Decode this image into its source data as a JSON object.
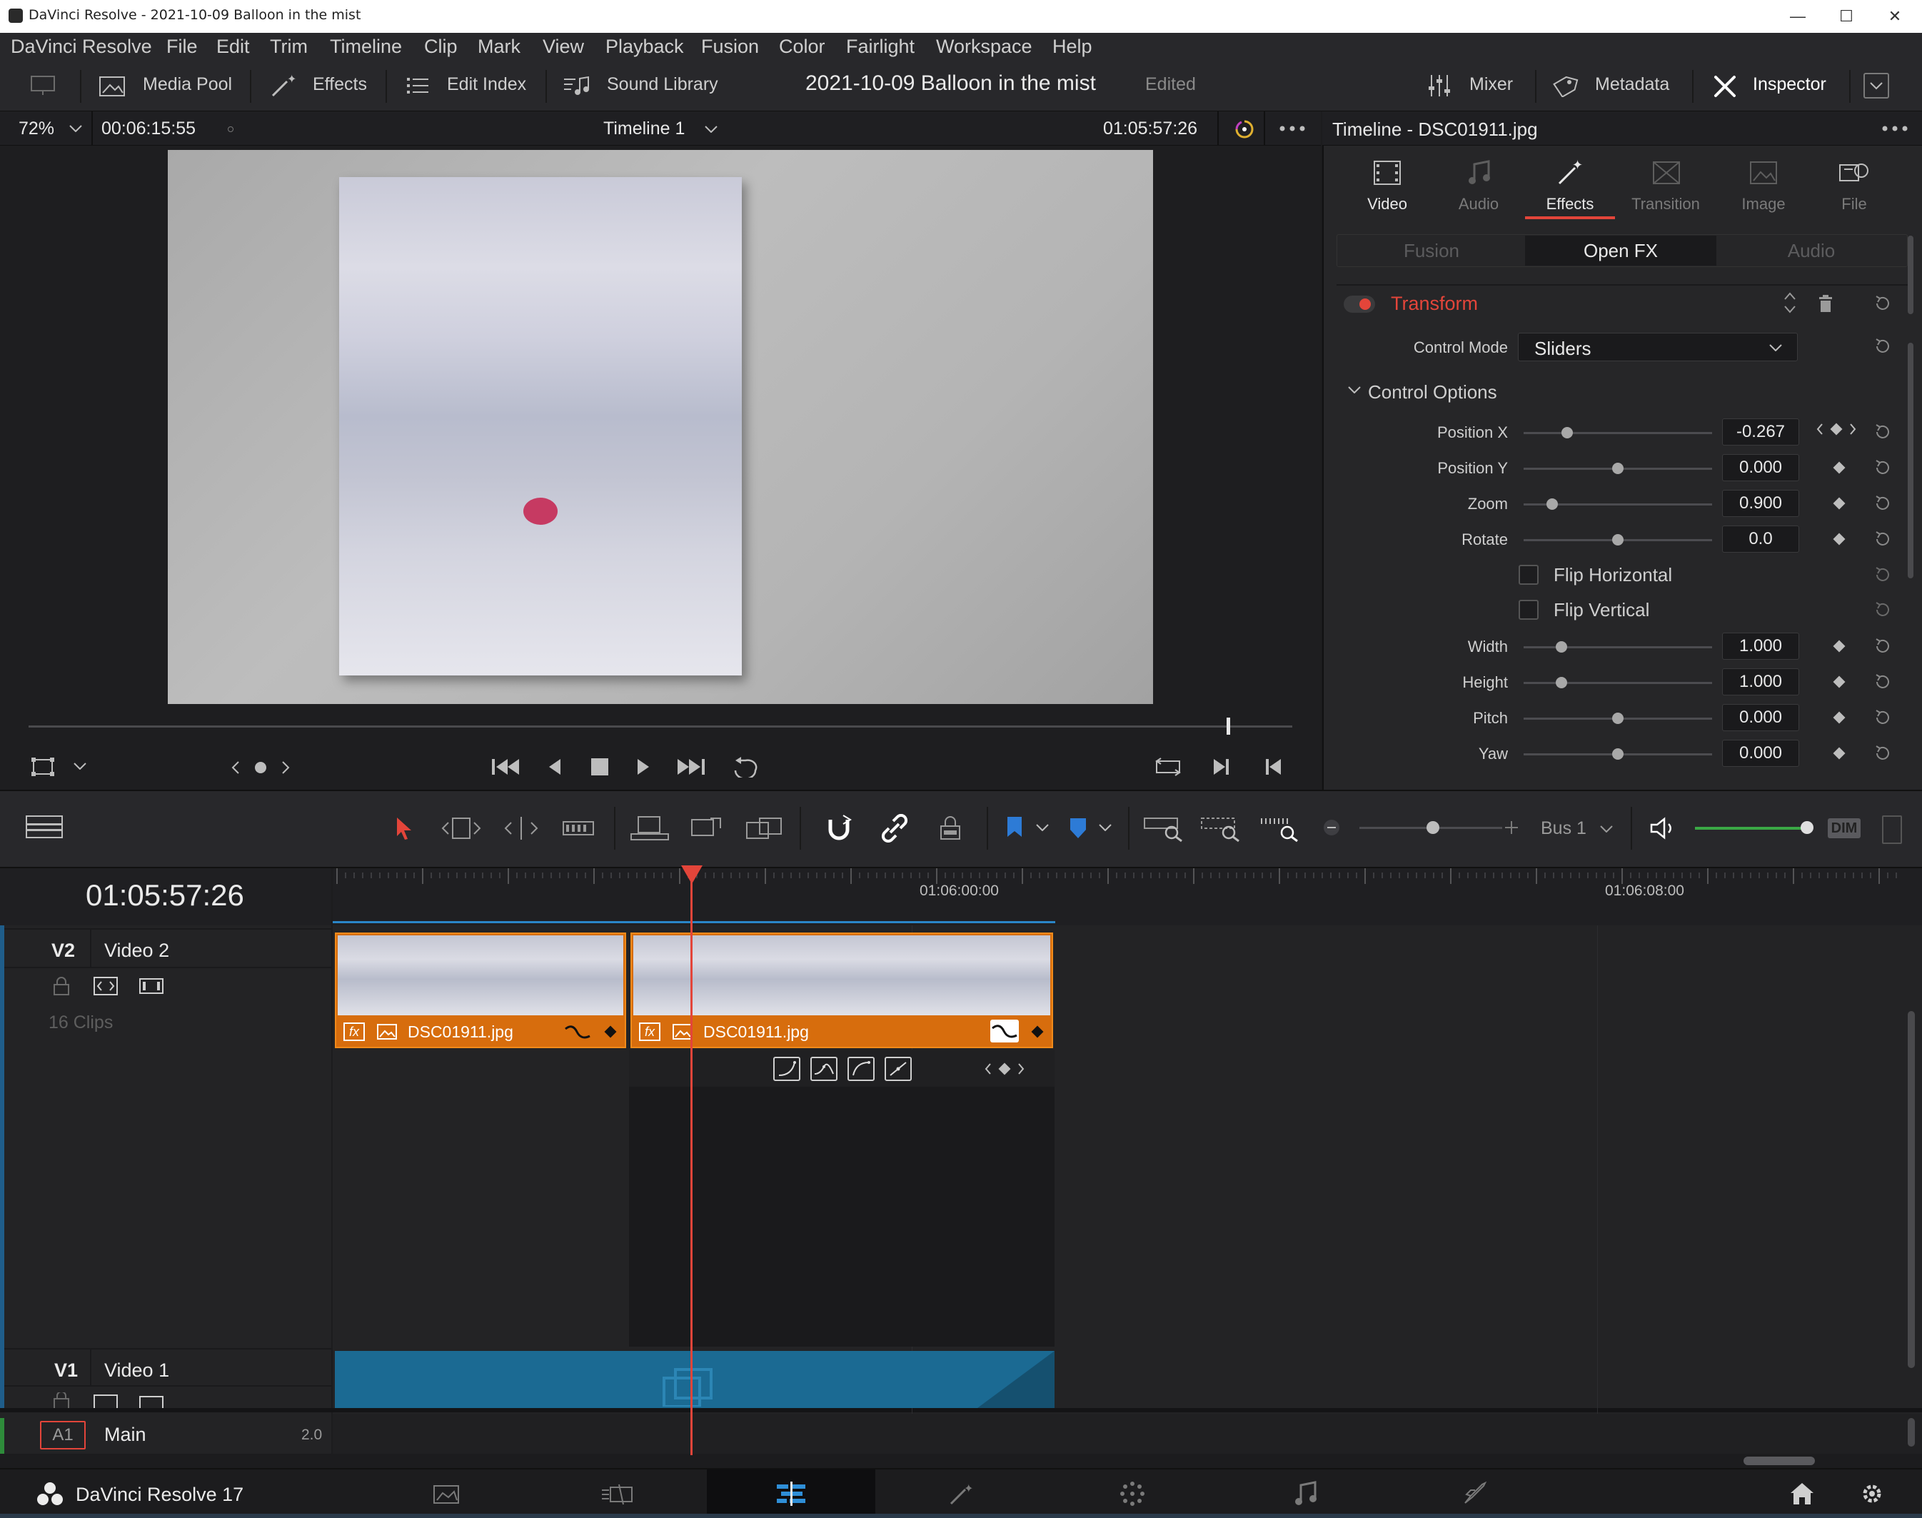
{
  "window": {
    "title": "DaVinci Resolve - 2021-10-09 Balloon in the mist",
    "minimize": "—",
    "maximize": "☐",
    "close": "✕"
  },
  "menu": [
    "DaVinci Resolve",
    "File",
    "Edit",
    "Trim",
    "Timeline",
    "Clip",
    "Mark",
    "View",
    "Playback",
    "Fusion",
    "Color",
    "Fairlight",
    "Workspace",
    "Help"
  ],
  "toolbar": {
    "media_pool": "Media Pool",
    "effects": "Effects",
    "edit_index": "Edit Index",
    "sound_library": "Sound Library",
    "project_title": "2021-10-09 Balloon in the mist",
    "status": "Edited",
    "mixer": "Mixer",
    "metadata": "Metadata",
    "inspector": "Inspector"
  },
  "viewer": {
    "zoom": "72%",
    "timecode_left": "00:06:15:55",
    "timeline_name": "Timeline 1",
    "timecode_right": "01:05:57:26"
  },
  "inspector": {
    "header": "Timeline - DSC01911.jpg",
    "tabs": [
      {
        "label": "Video",
        "icon": "video-icon"
      },
      {
        "label": "Audio",
        "icon": "audio-icon"
      },
      {
        "label": "Effects",
        "icon": "effects-wand-icon"
      },
      {
        "label": "Transition",
        "icon": "transition-icon"
      },
      {
        "label": "Image",
        "icon": "image-icon"
      },
      {
        "label": "File",
        "icon": "file-icon"
      }
    ],
    "active_tab": "Effects",
    "subtabs": [
      "Fusion",
      "Open FX",
      "Audio"
    ],
    "active_subtab": "Open FX",
    "effect_name": "Transform",
    "control_mode_label": "Control Mode",
    "control_mode_value": "Sliders",
    "section": "Control Options",
    "params": [
      {
        "label": "Position X",
        "value": "-0.267",
        "level": 0.23
      },
      {
        "label": "Position Y",
        "value": "0.000",
        "level": 0.5
      },
      {
        "label": "Zoom",
        "value": "0.900",
        "level": 0.15
      },
      {
        "label": "Rotate",
        "value": "0.0",
        "level": 0.5
      }
    ],
    "checkboxes": [
      "Flip Horizontal",
      "Flip Vertical"
    ],
    "params2": [
      {
        "label": "Width",
        "value": "1.000",
        "level": 0.2
      },
      {
        "label": "Height",
        "value": "1.000",
        "level": 0.2
      },
      {
        "label": "Pitch",
        "value": "0.000",
        "level": 0.5
      },
      {
        "label": "Yaw",
        "value": "0.000",
        "level": 0.5
      }
    ]
  },
  "timeline": {
    "timecode": "01:05:57:26",
    "ruler_labels": [
      "01:06:00:00",
      "01:06:08:00"
    ],
    "bus": "Bus 1",
    "dim": "DIM",
    "tracks": {
      "v2": {
        "id": "V2",
        "name": "Video 2",
        "clip_count": "16 Clips"
      },
      "v1": {
        "id": "V1",
        "name": "Video 1"
      },
      "a1": {
        "id": "A1",
        "name": "Main",
        "level": "2.0"
      }
    },
    "clips": [
      {
        "name": "DSC01911.jpg",
        "fx": "fx"
      },
      {
        "name": "DSC01911.jpg",
        "fx": "fx"
      }
    ]
  },
  "footer": {
    "app": "DaVinci Resolve 17"
  },
  "colors": {
    "accent_red": "#e3453a",
    "clip_orange": "#d76d0d",
    "video_blue": "#1b6a93",
    "marker_blue": "#2d7bd6",
    "audio_green": "#3aa845"
  }
}
